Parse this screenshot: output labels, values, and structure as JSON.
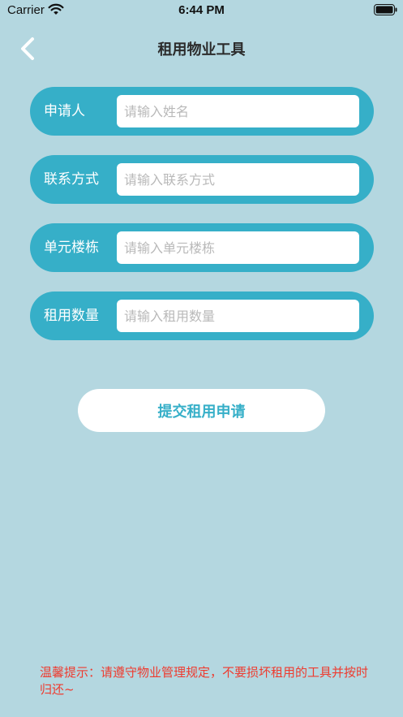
{
  "status_bar": {
    "carrier": "Carrier",
    "time": "6:44 PM"
  },
  "nav": {
    "title": "租用物业工具",
    "back_icon": "chevron-left-icon"
  },
  "form": {
    "rows": [
      {
        "label": "申请人",
        "placeholder": "请输入姓名",
        "value": ""
      },
      {
        "label": "联系方式",
        "placeholder": "请输入联系方式",
        "value": ""
      },
      {
        "label": "单元楼栋",
        "placeholder": "请输入单元楼栋",
        "value": ""
      },
      {
        "label": "租用数量",
        "placeholder": "请输入租用数量",
        "value": ""
      }
    ],
    "submit_label": "提交租用申请"
  },
  "tip": "温馨提示：请遵守物业管理规定，不要损坏租用的工具并按时归还~",
  "colors": {
    "background": "#b4d7e0",
    "accent": "#36afc8",
    "tip": "#ee3b2f"
  }
}
